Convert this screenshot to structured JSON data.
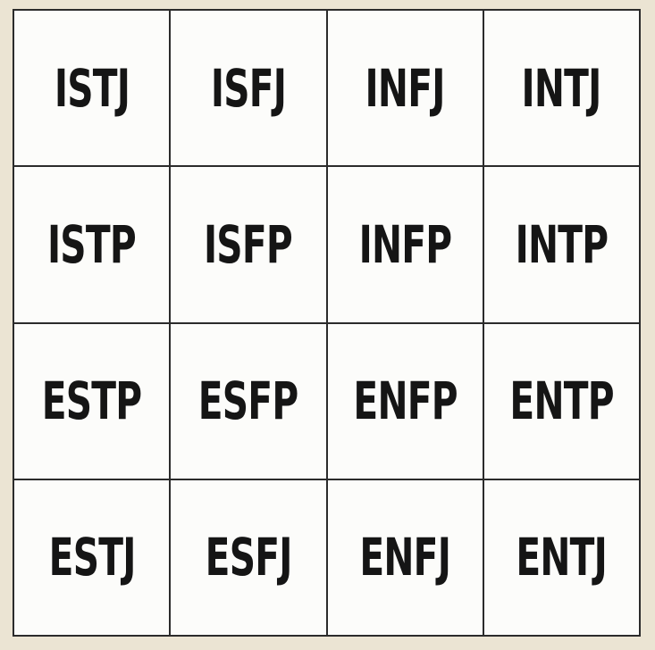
{
  "grid": {
    "rows": [
      [
        "ISTJ",
        "ISFJ",
        "INFJ",
        "INTJ"
      ],
      [
        "ISTP",
        "ISFP",
        "INFP",
        "INTP"
      ],
      [
        "ESTP",
        "ESFP",
        "ENFP",
        "ENTP"
      ],
      [
        "ESTJ",
        "ESFJ",
        "ENFJ",
        "ENTJ"
      ]
    ]
  }
}
